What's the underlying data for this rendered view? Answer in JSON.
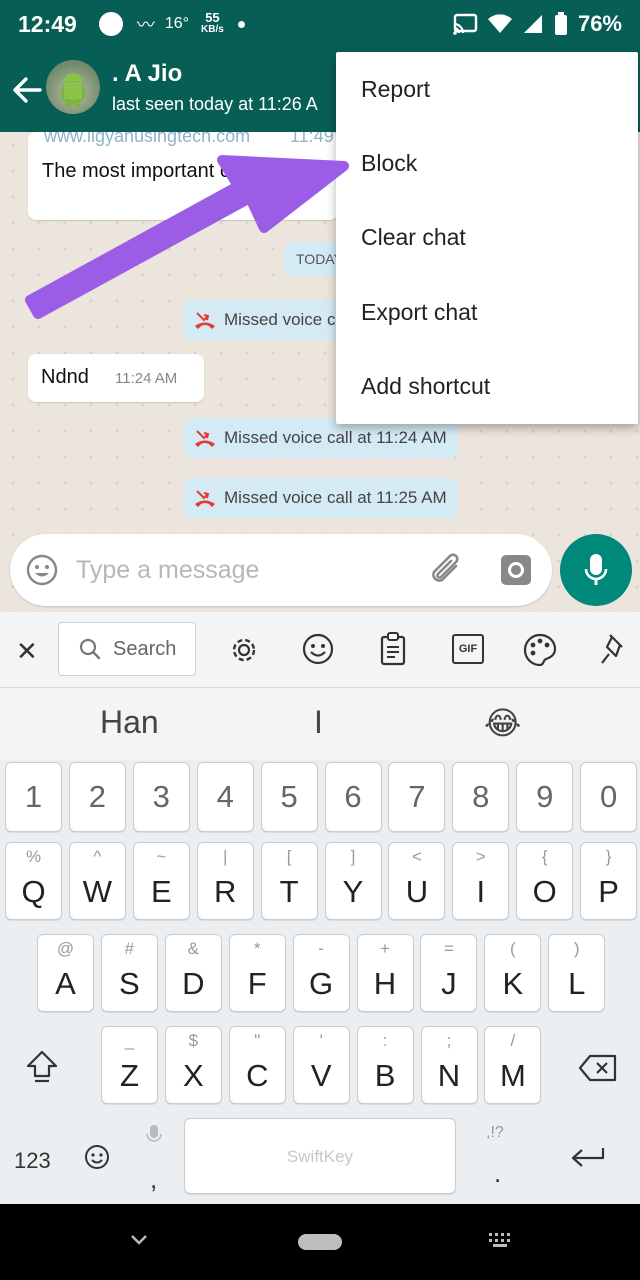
{
  "status_bar": {
    "time": "12:49",
    "temperature": "16°",
    "net_speed_value": "55",
    "net_speed_unit": "KB/s",
    "battery": "76%"
  },
  "app_bar": {
    "contact_name": ". A Jio",
    "last_seen": "last seen today at 11:26 A"
  },
  "menu": {
    "items": [
      "Report",
      "Block",
      "Clear chat",
      "Export chat",
      "Add shortcut"
    ]
  },
  "chat": {
    "top_message_faded": "www.ilgyanusingtech.com",
    "top_message_time_faded": "11:49",
    "top_message": "The most important of all",
    "date_chip": "TODAY",
    "missed_call_partial": "Missed voice c",
    "message_ndnd": "Ndnd",
    "message_ndnd_time": "11:24 AM",
    "missed_call_1": "Missed voice call at 11:24 AM",
    "missed_call_2": "Missed voice call at 11:25 AM"
  },
  "input": {
    "placeholder": "Type a message"
  },
  "keyboard": {
    "search_label": "Search",
    "gif_label": "GIF",
    "suggestions": [
      "Han",
      "I",
      "😂"
    ],
    "number_row": [
      "1",
      "2",
      "3",
      "4",
      "5",
      "6",
      "7",
      "8",
      "9",
      "0"
    ],
    "row1_main": [
      "Q",
      "W",
      "E",
      "R",
      "T",
      "Y",
      "U",
      "I",
      "O",
      "P"
    ],
    "row1_sub": [
      "%",
      "^",
      "~",
      "|",
      "[",
      "]",
      "<",
      ">",
      "{",
      "}"
    ],
    "row2_main": [
      "A",
      "S",
      "D",
      "F",
      "G",
      "H",
      "J",
      "K",
      "L"
    ],
    "row2_sub": [
      "@",
      "#",
      "&",
      "*",
      "-",
      "+",
      "=",
      "(",
      ")"
    ],
    "row3_main": [
      "Z",
      "X",
      "C",
      "V",
      "B",
      "N",
      "M"
    ],
    "row3_sub": [
      "_",
      "$",
      "\"",
      "'",
      ":",
      ";",
      "/"
    ],
    "numbers_key": "123",
    "space_label": "SwiftKey",
    "comma": ",",
    "period": ".",
    "punct_hint": ",!?"
  },
  "colors": {
    "header": "#075e54",
    "accent": "#00897b",
    "annotation_arrow": "#9b5de5"
  }
}
